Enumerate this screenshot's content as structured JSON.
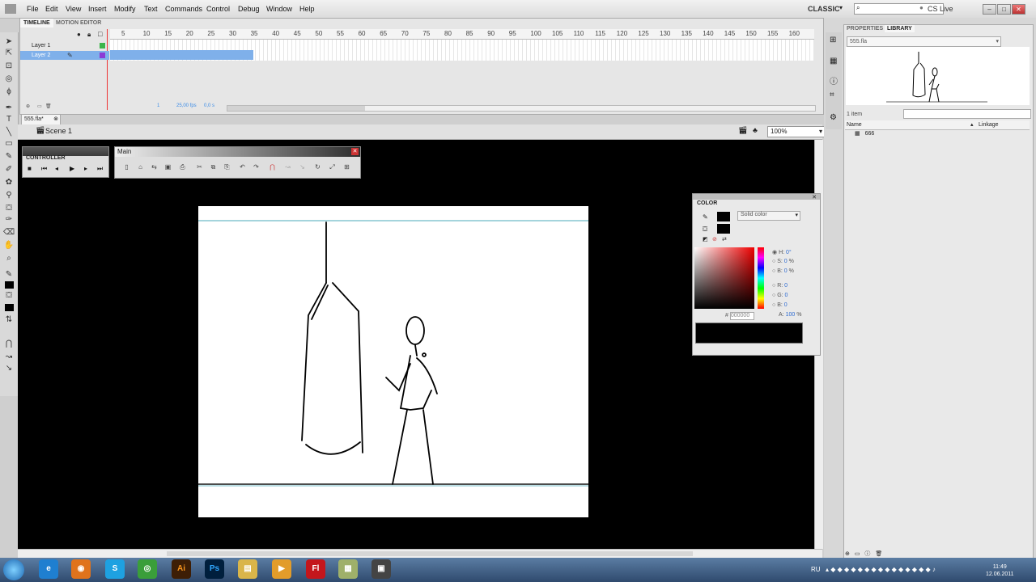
{
  "menubar": {
    "items": [
      "File",
      "Edit",
      "View",
      "Insert",
      "Modify",
      "Text",
      "Commands",
      "Control",
      "Debug",
      "Window",
      "Help"
    ],
    "workspace": "CLASSIC",
    "cs_live": "CS Live"
  },
  "timeline": {
    "tabs": [
      "TIMELINE",
      "MOTION EDITOR"
    ],
    "ruler": [
      "5",
      "10",
      "15",
      "20",
      "25",
      "30",
      "35",
      "40",
      "45",
      "50",
      "55",
      "60",
      "65",
      "70",
      "75",
      "80",
      "85",
      "90",
      "95",
      "100",
      "105",
      "110",
      "115",
      "120",
      "125",
      "130",
      "135",
      "140",
      "145",
      "150",
      "155",
      "160"
    ],
    "layers": [
      {
        "name": "Layer 1",
        "color": "#3bb54a",
        "selected": false
      },
      {
        "name": "Layer 2",
        "color": "#8c3bd6",
        "selected": true
      }
    ],
    "status": {
      "frame": "1",
      "fps": "25,00 fps",
      "time": "0,0 s"
    }
  },
  "document": {
    "tab": "555.fla*",
    "scene": "Scene 1",
    "zoom": "100%"
  },
  "controller": {
    "title": "CONTROLLER"
  },
  "main_toolbar": {
    "title": "Main"
  },
  "color_panel": {
    "title": "COLOR",
    "fill_type": "Solid color",
    "h": "0",
    "s": "0",
    "b": "0",
    "r": "0",
    "g": "0",
    "b2": "0",
    "alpha": "100",
    "hex": "000000",
    "labels": {
      "h": "H:",
      "s": "S:",
      "b": "B:",
      "r": "R:",
      "g": "G:",
      "b2": "B:",
      "a": "A:",
      "hash": "#"
    },
    "units": {
      "deg": "°",
      "pct": "%"
    }
  },
  "library": {
    "tabs": [
      "PROPERTIES",
      "LIBRARY"
    ],
    "doc": "555.fla",
    "count": "1 item",
    "col_name": "Name",
    "col_linkage": "Linkage",
    "items": [
      "666"
    ]
  },
  "taskbar": {
    "apps": [
      "Ai",
      "Ps",
      "Fl"
    ],
    "lang": "RU",
    "time": "11:49",
    "date": "12.06.2011"
  },
  "colors": {
    "stage": "#000000",
    "accent": "#3c8ce7",
    "layer_select": "#7fb0ea"
  }
}
